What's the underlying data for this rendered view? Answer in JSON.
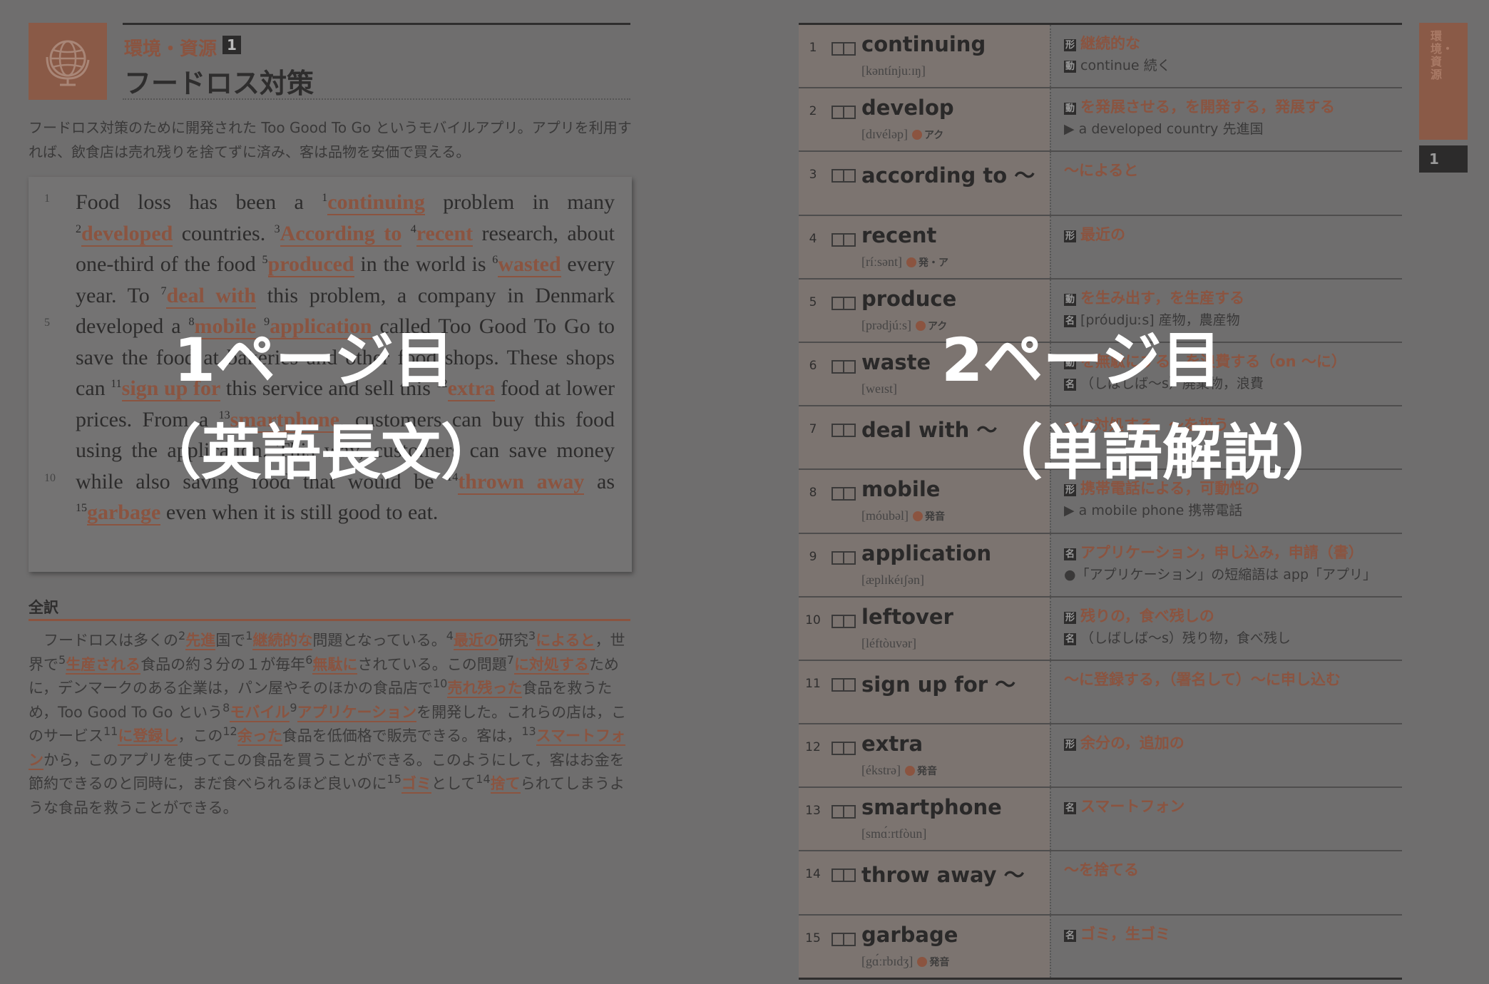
{
  "left": {
    "category": "環境・資源",
    "category_num": "1",
    "title": "フードロス対策",
    "intro": "フードロス対策のために開発された Too Good To Go というモバイルアプリ。アプリを利用すれば、飲食店は売れ残りを捨てずに済み、客は品物を安価で買える。",
    "passage_html": "Food loss has been a <span class=\"sup\">1</span><span class=\"kw\">continuing</span> problem in many <span class=\"sup\">2</span><span class=\"kw\">developed</span> countries. <span class=\"sup\">3</span><span class=\"kw\">According to</span> <span class=\"sup\">4</span><span class=\"kw\">recent</span> research, about one-third of the food <span class=\"sup\">5</span><span class=\"kw\">produced</span> in the world is <span class=\"sup\">6</span><span class=\"kw\">wasted</span> every year. To <span class=\"sup\">7</span><span class=\"kw\">deal with</span> this problem, a company in Denmark developed a <span class=\"sup\">8</span><span class=\"kw\">mobile</span> <span class=\"sup\">9</span><span class=\"kw\">application</span> called Too Good To Go to save the food at bakeries and other food shops. These shops can <span class=\"sup\">11</span><span class=\"kw\">sign up for</span> this service and sell this <span class=\"sup\">12</span><span class=\"kw\">extra</span> food at lower prices. From a <span class=\"sup\">13</span><span class=\"kw\">smartphone</span>, customers can buy this food using the application. This way, customers can save money while also saving food that would be <span class=\"sup\">14</span><span class=\"kw\">thrown away</span> as <span class=\"sup\">15</span><span class=\"kw\">garbage</span> even when it is still good to eat.",
    "line_numbers": [
      "1",
      "5",
      "10"
    ],
    "translation_label": "全訳",
    "translation_html": "　フードロスは多くの<span class=\"sup\">2</span><span class=\"tk\">先進</span>国で<span class=\"sup\">1</span><span class=\"tk\">継続的な</span>問題となっている。<span class=\"sup\">4</span><span class=\"tk\">最近の</span>研究<span class=\"sup\">3</span><span class=\"tk\">によると</span>，世界で<span class=\"sup\">5</span><span class=\"tk\">生産される</span>食品の約３分の１が毎年<span class=\"sup\">6</span><span class=\"tk\">無駄に</span>されている。この問題<span class=\"sup\">7</span><span class=\"tk\">に対処する</span>ために，デンマークのある企業は，パン屋やそのほかの食品店で<span class=\"sup\">10</span><span class=\"tk\">売れ残った</span>食品を救うため，Too Good To Go という<span class=\"sup\">8</span><span class=\"tk\">モバイル</span><span class=\"sup\">9</span><span class=\"tk\">アプリケーション</span>を開発した。これらの店は，このサービス<span class=\"sup\">11</span><span class=\"tk\">に登録し</span>，この<span class=\"sup\">12</span><span class=\"tk\">余った</span>食品を低価格で販売できる。客は，<span class=\"sup\">13</span><span class=\"tk\">スマートフォン</span>から，このアプリを使ってこの食品を買うことができる。このようにして，客はお金を節約できるのと同時に，まだ食べられるほど良いのに<span class=\"sup\">15</span><span class=\"tk\">ゴミ</span>として<span class=\"sup\">14</span><span class=\"tk\">捨て</span>られてしまうような食品を救うことができる。",
    "overlay_line1": "1ページ目",
    "overlay_line2": "（英語長文）"
  },
  "right": {
    "overlay_line1": "2ページ目",
    "overlay_line2": "（単語解説）",
    "side_tab": "環境・資源",
    "side_num": "1",
    "vocab": [
      {
        "num": "1",
        "word": "continuing",
        "pron": "[kəntínjuːɪŋ]",
        "acc": "",
        "m1": "継続的な",
        "m1pos": "形",
        "m2": "continue 続く",
        "m2pos": "動"
      },
      {
        "num": "2",
        "word": "develop",
        "pron": "[dɪvéləp]",
        "acc": "アク",
        "m1": "を発展させる，を開発する，発展する",
        "m1pos": "動",
        "m2": "▶ a developed country 先進国",
        "m2pos": ""
      },
      {
        "num": "3",
        "word": "according to ～",
        "pron": "",
        "acc": "",
        "m1": "～によると",
        "m1pos": "",
        "m2": "",
        "m2pos": ""
      },
      {
        "num": "4",
        "word": "recent",
        "pron": "[ríːsənt]",
        "acc": "発・ア",
        "m1": "最近の",
        "m1pos": "形",
        "m2": "",
        "m2pos": ""
      },
      {
        "num": "5",
        "word": "produce",
        "pron": "[prədjúːs]",
        "acc": "アク",
        "m1": "を生み出す，を生産する",
        "m1pos": "動",
        "m2": "[próudjuːs] 産物，農産物",
        "m2pos": "名"
      },
      {
        "num": "6",
        "word": "waste",
        "pron": "[weɪst]",
        "acc": "",
        "m1": "を無駄にする，を浪費する（on ～に）",
        "m1pos": "動",
        "m2": "（しばしば～s）廃棄物，浪費",
        "m2pos": "名"
      },
      {
        "num": "7",
        "word": "deal with ～",
        "pron": "",
        "acc": "",
        "m1": "～に対処する，～を扱う",
        "m1pos": "",
        "m2": "",
        "m2pos": ""
      },
      {
        "num": "8",
        "word": "mobile",
        "pron": "[móubəl]",
        "acc": "発音",
        "m1": "携帯電話による，可動性の",
        "m1pos": "形",
        "m2": "▶ a mobile phone 携帯電話",
        "m2pos": ""
      },
      {
        "num": "9",
        "word": "application",
        "pron": "[æplɪkéɪʃən]",
        "acc": "",
        "m1": "アプリケーション，申し込み，申請（書）",
        "m1pos": "名",
        "m2": "●「アプリケーション」の短縮語は app「アプリ」",
        "m2pos": ""
      },
      {
        "num": "10",
        "word": "leftover",
        "pron": "[léftòuvər]",
        "acc": "",
        "m1": "残りの，食べ残しの",
        "m1pos": "形",
        "m2": "（しばしば～s）残り物，食べ残し",
        "m2pos": "名"
      },
      {
        "num": "11",
        "word": "sign up for ～",
        "pron": "",
        "acc": "",
        "m1": "～に登録する，（署名して）～に申し込む",
        "m1pos": "",
        "m2": "",
        "m2pos": ""
      },
      {
        "num": "12",
        "word": "extra",
        "pron": "[ékstrə]",
        "acc": "発音",
        "m1": "余分の，追加の",
        "m1pos": "形",
        "m2": "",
        "m2pos": ""
      },
      {
        "num": "13",
        "word": "smartphone",
        "pron": "[smɑ́ːrtfòun]",
        "acc": "",
        "m1": "スマートフォン",
        "m1pos": "名",
        "m2": "",
        "m2pos": ""
      },
      {
        "num": "14",
        "word": "throw away ～",
        "pron": "",
        "acc": "",
        "m1": "～を捨てる",
        "m1pos": "",
        "m2": "",
        "m2pos": ""
      },
      {
        "num": "15",
        "word": "garbage",
        "pron": "[gɑ́ːrbɪdʒ]",
        "acc": "発音",
        "m1": "ゴミ，生ゴミ",
        "m1pos": "名",
        "m2": "",
        "m2pos": ""
      }
    ]
  }
}
